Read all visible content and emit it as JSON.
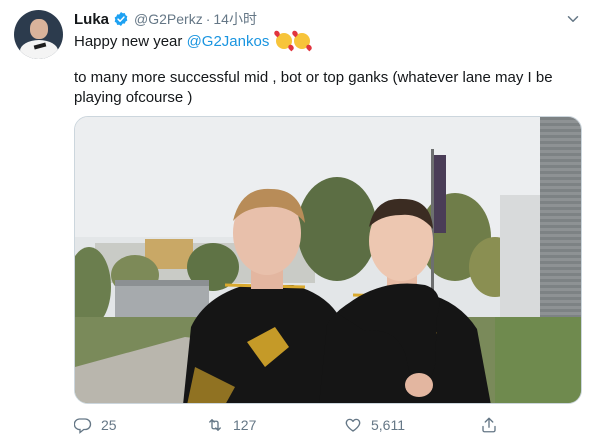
{
  "tweet": {
    "author_name": "Luka",
    "handle": "@G2Perkz",
    "separator": "·",
    "time": "14小时",
    "line1_text": "Happy new year ",
    "mention": "@G2Jankos",
    "body": "to many more successful mid , bot or top ganks (whatever lane may I be playing ofcourse )",
    "emojis": [
      "smiling-face-with-hearts",
      "smiling-face-with-hearts"
    ]
  },
  "actions": {
    "replies": "25",
    "retweets": "127",
    "likes": "5,611"
  },
  "icons": {
    "verified": "verified-badge-icon",
    "menu": "chevron-down-icon",
    "reply": "reply-icon",
    "retweet": "retweet-icon",
    "like": "heart-icon",
    "share": "share-icon"
  },
  "colors": {
    "accent": "#1b95e0",
    "muted": "#657786",
    "text": "#14171a"
  }
}
